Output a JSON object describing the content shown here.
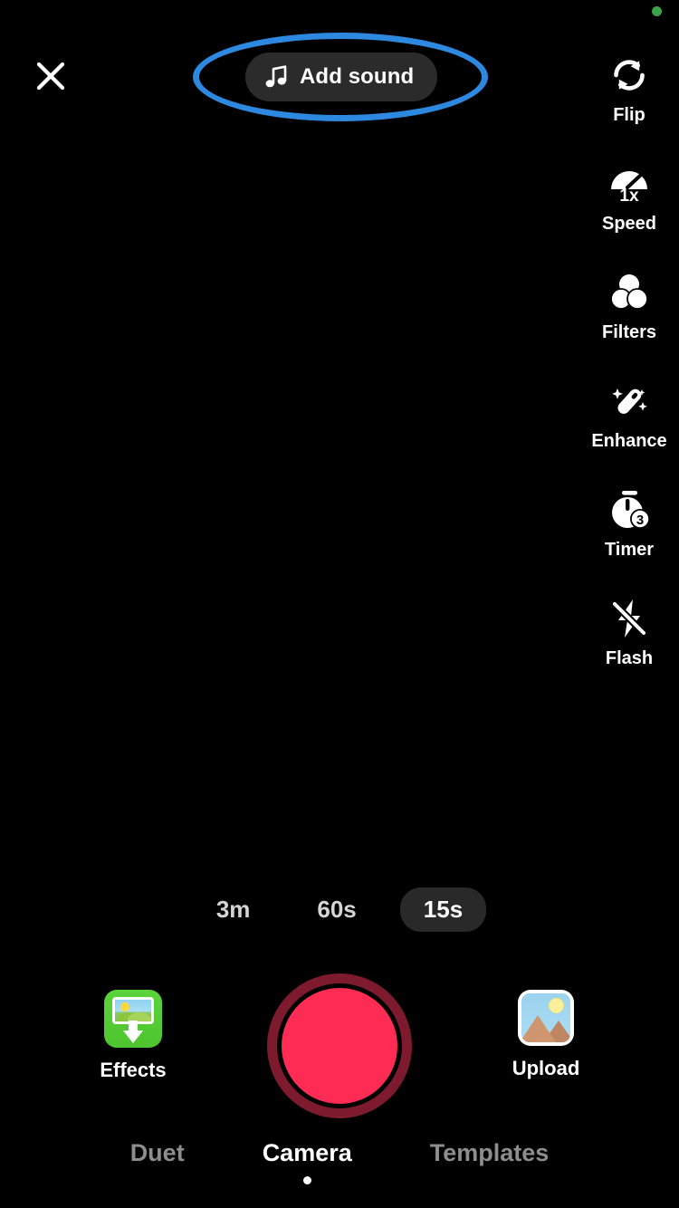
{
  "app": {
    "screen_title": "Camera",
    "background_color": "#000000"
  },
  "status": {
    "privacy_indicator": "green-dot"
  },
  "header": {
    "close_label": "Close",
    "close_icon": "close-x-icon",
    "add_sound": {
      "label": "Add sound",
      "icon": "music-note-icon",
      "pill_color": "#2B2B2B"
    },
    "annotation": {
      "shape": "ellipse",
      "color": "#2D88E0",
      "target": "Add sound"
    }
  },
  "tools": [
    {
      "label": "Flip",
      "icon": "flip-camera-icon"
    },
    {
      "label": "Speed",
      "icon": "speed-gauge-icon",
      "value": "1x"
    },
    {
      "label": "Filters",
      "icon": "filters-circles-icon"
    },
    {
      "label": "Enhance",
      "icon": "magic-wand-icon"
    },
    {
      "label": "Timer",
      "icon": "stopwatch-icon",
      "value": "3"
    },
    {
      "label": "Flash",
      "icon": "flash-off-icon"
    }
  ],
  "duration": {
    "options": [
      {
        "label": "3m",
        "selected": false
      },
      {
        "label": "60s",
        "selected": false
      },
      {
        "label": "15s",
        "selected": true
      }
    ]
  },
  "capture": {
    "record_label": "Record",
    "record_color": "#FE2C55",
    "record_ring_color": "#7D1A2E",
    "effects": {
      "label": "Effects",
      "icon": "effects-image-download-icon"
    },
    "upload": {
      "label": "Upload",
      "icon": "photo-picture-icon"
    }
  },
  "mode_tabs": [
    {
      "label": "Duet",
      "active": false
    },
    {
      "label": "Camera",
      "active": true
    },
    {
      "label": "Templates",
      "active": false
    }
  ]
}
